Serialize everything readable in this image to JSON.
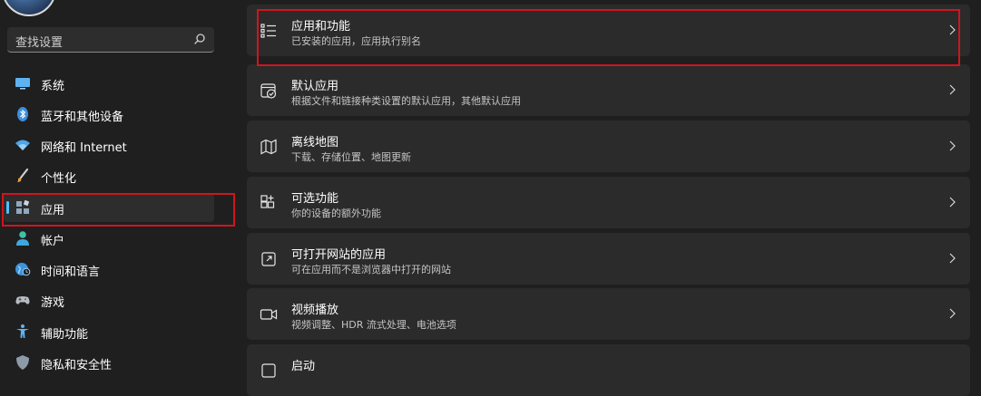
{
  "search": {
    "placeholder": "查找设置"
  },
  "sidebar": {
    "items": [
      {
        "label": "系统",
        "icon": "monitor-icon"
      },
      {
        "label": "蓝牙和其他设备",
        "icon": "bluetooth-icon"
      },
      {
        "label": "网络和 Internet",
        "icon": "wifi-icon"
      },
      {
        "label": "个性化",
        "icon": "brush-icon"
      },
      {
        "label": "应用",
        "icon": "apps-icon",
        "selected": true
      },
      {
        "label": "帐户",
        "icon": "person-icon"
      },
      {
        "label": "时间和语言",
        "icon": "globe-clock-icon"
      },
      {
        "label": "游戏",
        "icon": "gamepad-icon"
      },
      {
        "label": "辅助功能",
        "icon": "accessibility-icon"
      },
      {
        "label": "隐私和安全性",
        "icon": "shield-icon"
      }
    ]
  },
  "main": {
    "cards": [
      {
        "title": "应用和功能",
        "subtitle": "已安装的应用，应用执行别名",
        "icon": "list-icon"
      },
      {
        "title": "默认应用",
        "subtitle": "根据文件和链接种类设置的默认应用，其他默认应用",
        "icon": "default-app-icon"
      },
      {
        "title": "离线地图",
        "subtitle": "下载、存储位置、地图更新",
        "icon": "map-icon"
      },
      {
        "title": "可选功能",
        "subtitle": "你的设备的额外功能",
        "icon": "add-feature-icon"
      },
      {
        "title": "可打开网站的应用",
        "subtitle": "可在应用而不是浏览器中打开的网站",
        "icon": "open-website-icon"
      },
      {
        "title": "视频播放",
        "subtitle": "视频调整、HDR 流式处理、电池选项",
        "icon": "video-icon"
      },
      {
        "title": "启动",
        "subtitle": "",
        "icon": "startup-icon"
      }
    ]
  },
  "colors": {
    "accent": "#4cc2ff",
    "highlight": "#d0151e",
    "background": "#1f1f1f",
    "card": "#2b2b2b"
  }
}
